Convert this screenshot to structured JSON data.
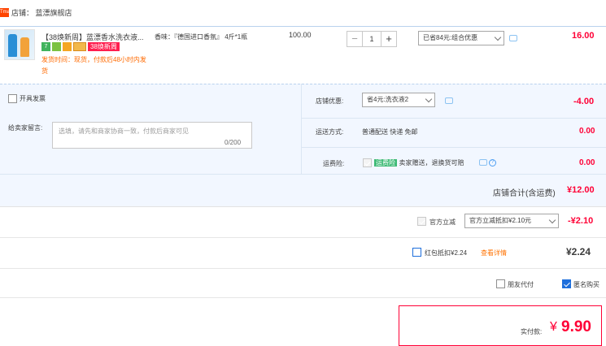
{
  "shop": {
    "tag": "Tmall",
    "label": "店铺：  蓝漂旗舰店"
  },
  "item": {
    "title": "【38焕新周】蓝漂香水洗衣液...",
    "badge_7": "7",
    "badge_promo": "38焕新周",
    "ship_text": "发货时间：现货，付款后48小时内发货",
    "sku": "香味：『德国进口香氛』 4斤*1瓶",
    "price": "100.00",
    "qty": "1",
    "qty_minus": "−",
    "qty_plus": "+",
    "discount_select": "已省84元:组合优惠",
    "subtotal": "16.00"
  },
  "invoice": {
    "label": "开具发票"
  },
  "memo": {
    "label": "给卖家留言:",
    "placeholder": "选填，请先和商家协商一致，付款后商家可见",
    "count": "0/200"
  },
  "shop_discount": {
    "label": "店铺优惠:",
    "select": "省4元:洗衣液2",
    "value": "-4.00"
  },
  "delivery": {
    "label": "运送方式:",
    "value_text": "普通配送 快递 免邮",
    "value": "0.00"
  },
  "insurance": {
    "label": "运费险:",
    "tag": "运费险",
    "text": "卖家赠送，退换货可赔",
    "help": "?",
    "value": "0.00"
  },
  "shop_total": {
    "label": "店铺合计(含运费)",
    "value": "¥12.00"
  },
  "official_discount": {
    "label": "官方立减",
    "select": "官方立减抵扣¥2.10元",
    "value": "-¥2.10"
  },
  "redpacket": {
    "label": "红包抵扣¥2.24",
    "link": "查看详情",
    "value": "¥2.24"
  },
  "friend_pay": {
    "label": "朋友代付"
  },
  "anonymous": {
    "label": "匿名购买"
  },
  "payment": {
    "label": "实付款:",
    "currency": "¥",
    "amount": "9.90"
  },
  "colors": {
    "accent": "#ff0036",
    "link_orange": "#ff7200",
    "option_bg": "#f2f7ff",
    "checkbox_blue": "#1e6fdc"
  }
}
